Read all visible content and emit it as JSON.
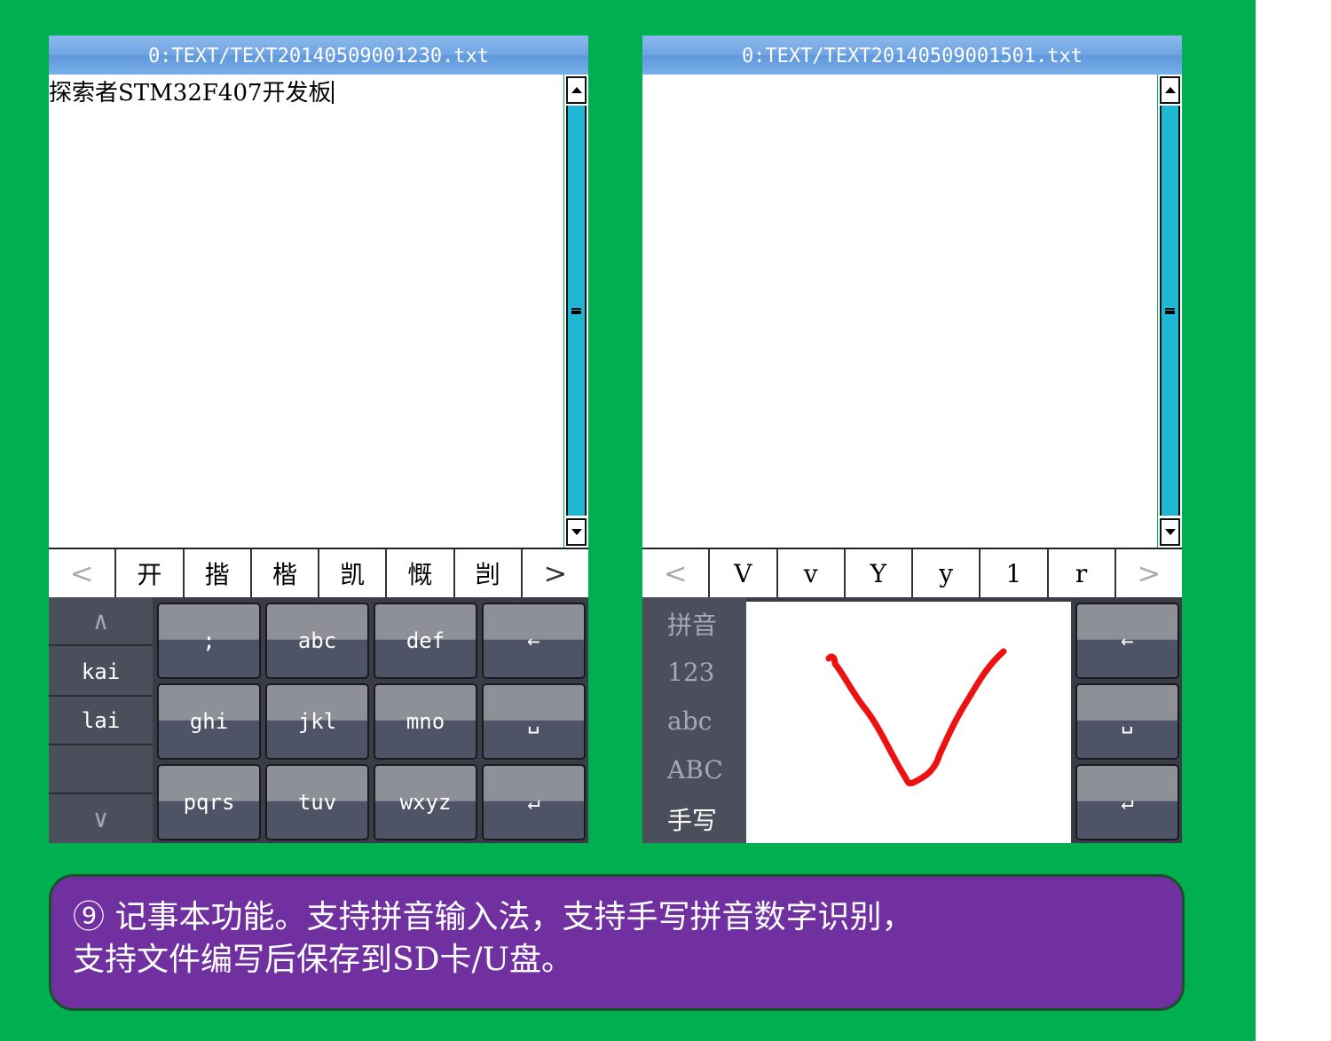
{
  "left_window": {
    "title": "0:TEXT/TEXT20140509001230.txt",
    "content": "探索者STM32F407开发板",
    "candidates": {
      "prev": "<",
      "items": [
        "开",
        "揩",
        "楷",
        "凯",
        "慨",
        "剀"
      ],
      "next": ">"
    },
    "pinyin_list": {
      "up": "∧",
      "items": [
        "kai",
        "lai",
        ""
      ],
      "down": "∨"
    },
    "keys": [
      ";",
      "abc",
      "def",
      "←",
      "ghi",
      "jkl",
      "mno",
      "␣",
      "pqrs",
      "tuv",
      "wxyz",
      "↵"
    ]
  },
  "right_window": {
    "title": "0:TEXT/TEXT20140509001501.txt",
    "content": "",
    "candidates": {
      "prev": "<",
      "items": [
        "V",
        "v",
        "Y",
        "y",
        "1",
        "r"
      ],
      "next": ">"
    },
    "ime_modes": [
      "拼音",
      "123",
      "abc",
      "ABC",
      "手写"
    ],
    "active_mode": "手写",
    "keys": [
      "←",
      "␣",
      "↵"
    ],
    "stroke_color": "#ee1111"
  },
  "caption": {
    "line1": "⑨ 记事本功能。支持拼音输入法，支持手写拼音数字识别，",
    "line2": "支持文件编写后保存到SD卡/U盘。"
  },
  "colors": {
    "background": "#00b050",
    "caption_bg": "#7030a0",
    "scroll_thumb": "#1fb8d4"
  }
}
